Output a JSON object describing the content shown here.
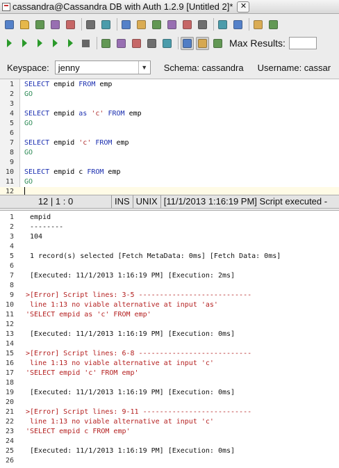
{
  "window": {
    "title": "cassandra@Cassandra DB with Auth 1.2.9 [Untitled 2]*"
  },
  "toolbar": {
    "row1_icons": [
      "new-file-icon",
      "open-folder-icon",
      "save-icon",
      "save-all-icon",
      "save-as-icon",
      "print-icon",
      "page-setup-icon",
      "select-icon",
      "cut-icon",
      "copy-icon",
      "paste-icon",
      "undo-icon",
      "redo-icon",
      "connect-icon",
      "disconnect-icon",
      "sort-icon",
      "sort-reverse-icon"
    ],
    "row2_icons": [
      "run-all-icon",
      "execute-icon",
      "execute-current-icon",
      "execute-to-file-icon",
      "execute-explain-icon",
      "stop-icon",
      "commit-icon",
      "rollback-icon",
      "rollback-all-icon",
      "auto-commit-icon",
      "query-builder-icon",
      "grid-view-icon",
      "text-view-icon",
      "export-icon"
    ],
    "max_results_label": "Max Results:",
    "max_results_value": ""
  },
  "context": {
    "keyspace_label": "Keyspace:",
    "keyspace_value": "jenny",
    "schema_text": "Schema: cassandra",
    "username_text": "Username: cassar"
  },
  "editor": {
    "lines": [
      {
        "n": "1",
        "code": "SELECT empid FROM emp"
      },
      {
        "n": "2",
        "code": "GO"
      },
      {
        "n": "3",
        "code": ""
      },
      {
        "n": "4",
        "code": "SELECT empid as 'c' FROM emp"
      },
      {
        "n": "5",
        "code": "GO"
      },
      {
        "n": "6",
        "code": ""
      },
      {
        "n": "7",
        "code": "SELECT empid 'c' FROM emp"
      },
      {
        "n": "8",
        "code": "GO"
      },
      {
        "n": "9",
        "code": ""
      },
      {
        "n": "10",
        "code": "SELECT empid c FROM emp"
      },
      {
        "n": "11",
        "code": "GO"
      },
      {
        "n": "12",
        "code": ""
      }
    ]
  },
  "status": {
    "position": "12 | 1 : 0",
    "mode": "INS",
    "line_ending": "UNIX",
    "message": "[11/1/2013 1:16:19 PM] Script executed -"
  },
  "output": {
    "lines": [
      {
        "n": "1",
        "text": " empid",
        "error": false
      },
      {
        "n": "2",
        "text": " --------",
        "error": false
      },
      {
        "n": "3",
        "text": " 104",
        "error": false
      },
      {
        "n": "4",
        "text": "",
        "error": false
      },
      {
        "n": "5",
        "text": " 1 record(s) selected [Fetch MetaData: 0ms] [Fetch Data: 0ms]",
        "error": false
      },
      {
        "n": "6",
        "text": "",
        "error": false
      },
      {
        "n": "7",
        "text": " [Executed: 11/1/2013 1:16:19 PM] [Execution: 2ms]",
        "error": false
      },
      {
        "n": "8",
        "text": "",
        "error": false
      },
      {
        "n": "9",
        "text": ">[Error] Script lines: 3-5 ---------------------------",
        "error": true
      },
      {
        "n": "10",
        "text": " line 1:13 no viable alternative at input 'as'",
        "error": true
      },
      {
        "n": "11",
        "text": "'SELECT empid as 'c' FROM emp'",
        "error": true
      },
      {
        "n": "12",
        "text": "",
        "error": false
      },
      {
        "n": "13",
        "text": " [Executed: 11/1/2013 1:16:19 PM] [Execution: 0ms]",
        "error": false
      },
      {
        "n": "14",
        "text": "",
        "error": false
      },
      {
        "n": "15",
        "text": ">[Error] Script lines: 6-8 ---------------------------",
        "error": true
      },
      {
        "n": "16",
        "text": " line 1:13 no viable alternative at input 'c'",
        "error": true
      },
      {
        "n": "17",
        "text": "'SELECT empid 'c' FROM emp'",
        "error": true
      },
      {
        "n": "18",
        "text": "",
        "error": false
      },
      {
        "n": "19",
        "text": " [Executed: 11/1/2013 1:16:19 PM] [Execution: 0ms]",
        "error": false
      },
      {
        "n": "20",
        "text": "",
        "error": false
      },
      {
        "n": "21",
        "text": ">[Error] Script lines: 9-11 --------------------------",
        "error": true
      },
      {
        "n": "22",
        "text": " line 1:13 no viable alternative at input 'c'",
        "error": true
      },
      {
        "n": "23",
        "text": "'SELECT empid c FROM emp'",
        "error": true
      },
      {
        "n": "24",
        "text": "",
        "error": false
      },
      {
        "n": "25",
        "text": " [Executed: 11/1/2013 1:16:19 PM] [Execution: 0ms]",
        "error": false
      },
      {
        "n": "26",
        "text": "",
        "error": false
      }
    ]
  },
  "colors": {
    "keyword": "#1b2fb0",
    "go": "#2e8b57",
    "string": "#b03030",
    "error": "#b42020"
  }
}
